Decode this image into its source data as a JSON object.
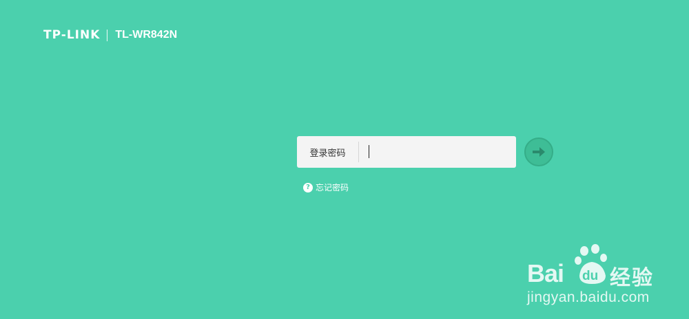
{
  "brand": {
    "logo": "TP-LINK",
    "model": "TL-WR842N"
  },
  "login": {
    "label": "登录密码",
    "password_value": "",
    "placeholder": "",
    "submit_icon": "arrow-right-icon"
  },
  "forgot": {
    "icon": "help-icon",
    "label": "忘记密码"
  },
  "watermark": {
    "bai": "Bai",
    "du": "du",
    "jingyan": "经验",
    "url": "jingyan.baidu.com"
  },
  "colors": {
    "background": "#4bd0ad",
    "input_bg": "#f4f4f4",
    "button": "#3ebd96",
    "arrow": "#2a8a6c"
  }
}
